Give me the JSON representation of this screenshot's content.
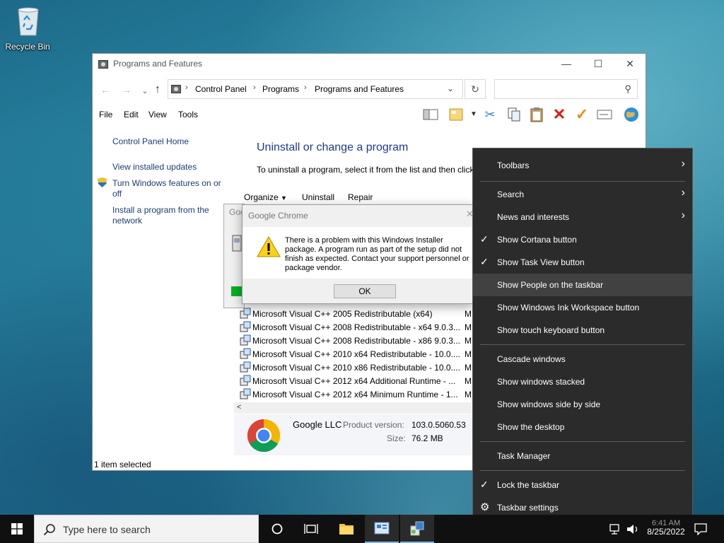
{
  "desktop": {
    "recycle_bin_label": "Recycle Bin"
  },
  "window": {
    "title": "Programs and Features",
    "caption": {
      "minimize": "—",
      "maximize": "☐",
      "close": "✕"
    },
    "breadcrumb": [
      "Control Panel",
      "Programs and Features"
    ],
    "breadcrumb_root": "Programs",
    "search_placeholder": "",
    "menu": [
      "File",
      "Edit",
      "View",
      "Tools"
    ],
    "left_links": {
      "home": "Control Panel Home",
      "updates": "View installed updates",
      "features": "Turn Windows features on or off",
      "network": "Install a program from the network"
    },
    "heading": "Uninstall or change a program",
    "description": "To uninstall a program, select it from the list and then click",
    "commands": {
      "organize": "Organize",
      "uninstall": "Uninstall",
      "repair": "Repair"
    },
    "programs": [
      {
        "name": "Microsoft Visual C++ 2005 Redistributable (x64)",
        "publisher": "M"
      },
      {
        "name": "Microsoft Visual C++ 2008 Redistributable - x64 9.0.3...",
        "publisher": "M"
      },
      {
        "name": "Microsoft Visual C++ 2008 Redistributable - x86 9.0.3...",
        "publisher": "M"
      },
      {
        "name": "Microsoft Visual C++ 2010  x64 Redistributable - 10.0....",
        "publisher": "M"
      },
      {
        "name": "Microsoft Visual C++ 2010  x86 Redistributable - 10.0....",
        "publisher": "M"
      },
      {
        "name": "Microsoft Visual C++ 2012 x64 Additional Runtime - ...",
        "publisher": "M"
      },
      {
        "name": "Microsoft Visual C++ 2012 x64 Minimum Runtime - 1...",
        "publisher": "M"
      }
    ],
    "details": {
      "publisher": "Google LLC",
      "version_label": "Product version:",
      "version": "103.0.5060.53",
      "size_label": "Size:",
      "size": "76.2 MB"
    },
    "status": "1 item selected"
  },
  "back_dialog": {
    "title_fragment": "Goo"
  },
  "dialog": {
    "title": "Google Chrome",
    "message": "There is a problem with this Windows Installer package. A program run as part of the setup did not finish as expected. Contact your support personnel or package vendor.",
    "ok": "OK"
  },
  "context_menu": {
    "items": [
      {
        "label": "Toolbars",
        "checked": false,
        "submenu": true
      },
      {
        "label": "Search",
        "checked": false,
        "submenu": true
      },
      {
        "label": "News and interests",
        "checked": false,
        "submenu": true
      },
      {
        "label": "Show Cortana button",
        "checked": true,
        "submenu": false
      },
      {
        "label": "Show Task View button",
        "checked": true,
        "submenu": false
      },
      {
        "label": "Show People on the taskbar",
        "checked": false,
        "submenu": false,
        "highlighted": true
      },
      {
        "label": "Show Windows Ink Workspace button",
        "checked": false,
        "submenu": false
      },
      {
        "label": "Show touch keyboard button",
        "checked": false,
        "submenu": false
      },
      {
        "label": "Cascade windows",
        "checked": false,
        "submenu": false
      },
      {
        "label": "Show windows stacked",
        "checked": false,
        "submenu": false
      },
      {
        "label": "Show windows side by side",
        "checked": false,
        "submenu": false
      },
      {
        "label": "Show the desktop",
        "checked": false,
        "submenu": false
      },
      {
        "label": "Task Manager",
        "checked": false,
        "submenu": false
      },
      {
        "label": "Lock the taskbar",
        "checked": true,
        "submenu": false
      },
      {
        "label": "Taskbar settings",
        "checked": false,
        "submenu": false,
        "icon": "gear-icon"
      }
    ]
  },
  "taskbar": {
    "search_placeholder": "Type here to search",
    "date": "8/25/2022",
    "time": "6:41 AM"
  },
  "colors": {
    "link": "#1a3e73",
    "heading": "#1e3b8c",
    "menu_bg": "#2b2b2b",
    "menu_highlight": "#414141",
    "taskbar": "#101010",
    "error_red": "#e0161b",
    "check_orange": "#f08a1c"
  }
}
